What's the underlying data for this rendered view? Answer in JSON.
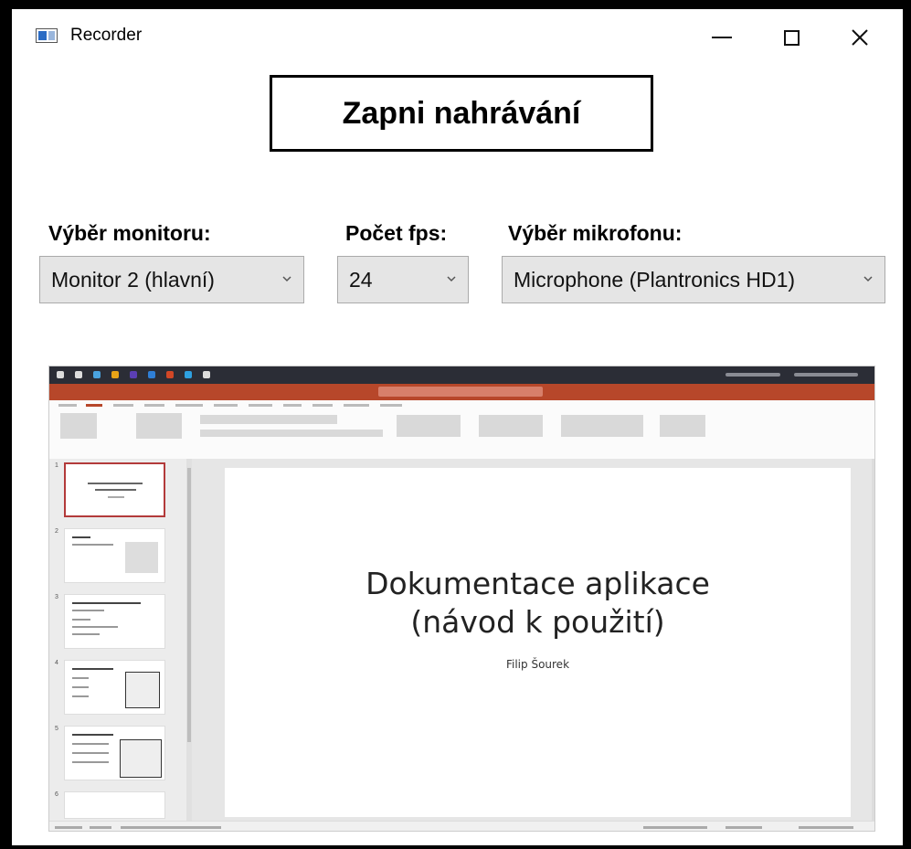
{
  "window": {
    "title": "Recorder",
    "controls": [
      "minimize",
      "maximize",
      "close"
    ]
  },
  "record_button": {
    "label": "Zapni nahrávání"
  },
  "monitor": {
    "label": "Výběr monitoru:",
    "value": "Monitor 2 (hlavní)"
  },
  "fps": {
    "label": "Počet fps:",
    "value": "24"
  },
  "microphone": {
    "label": "Výběr mikrofonu:",
    "value": "Microphone (Plantronics HD1)"
  },
  "preview": {
    "slide_title_line1": "Dokumentace aplikace",
    "slide_title_line2": "(návod k použití)",
    "slide_author": "Filip Šourek",
    "slide_numbers": [
      "1",
      "2",
      "3",
      "4",
      "5",
      "6"
    ],
    "colors": {
      "powerpoint": "#b7472a",
      "taskbar": "#2b2d36",
      "selected_slide": "#b33a3a"
    }
  }
}
